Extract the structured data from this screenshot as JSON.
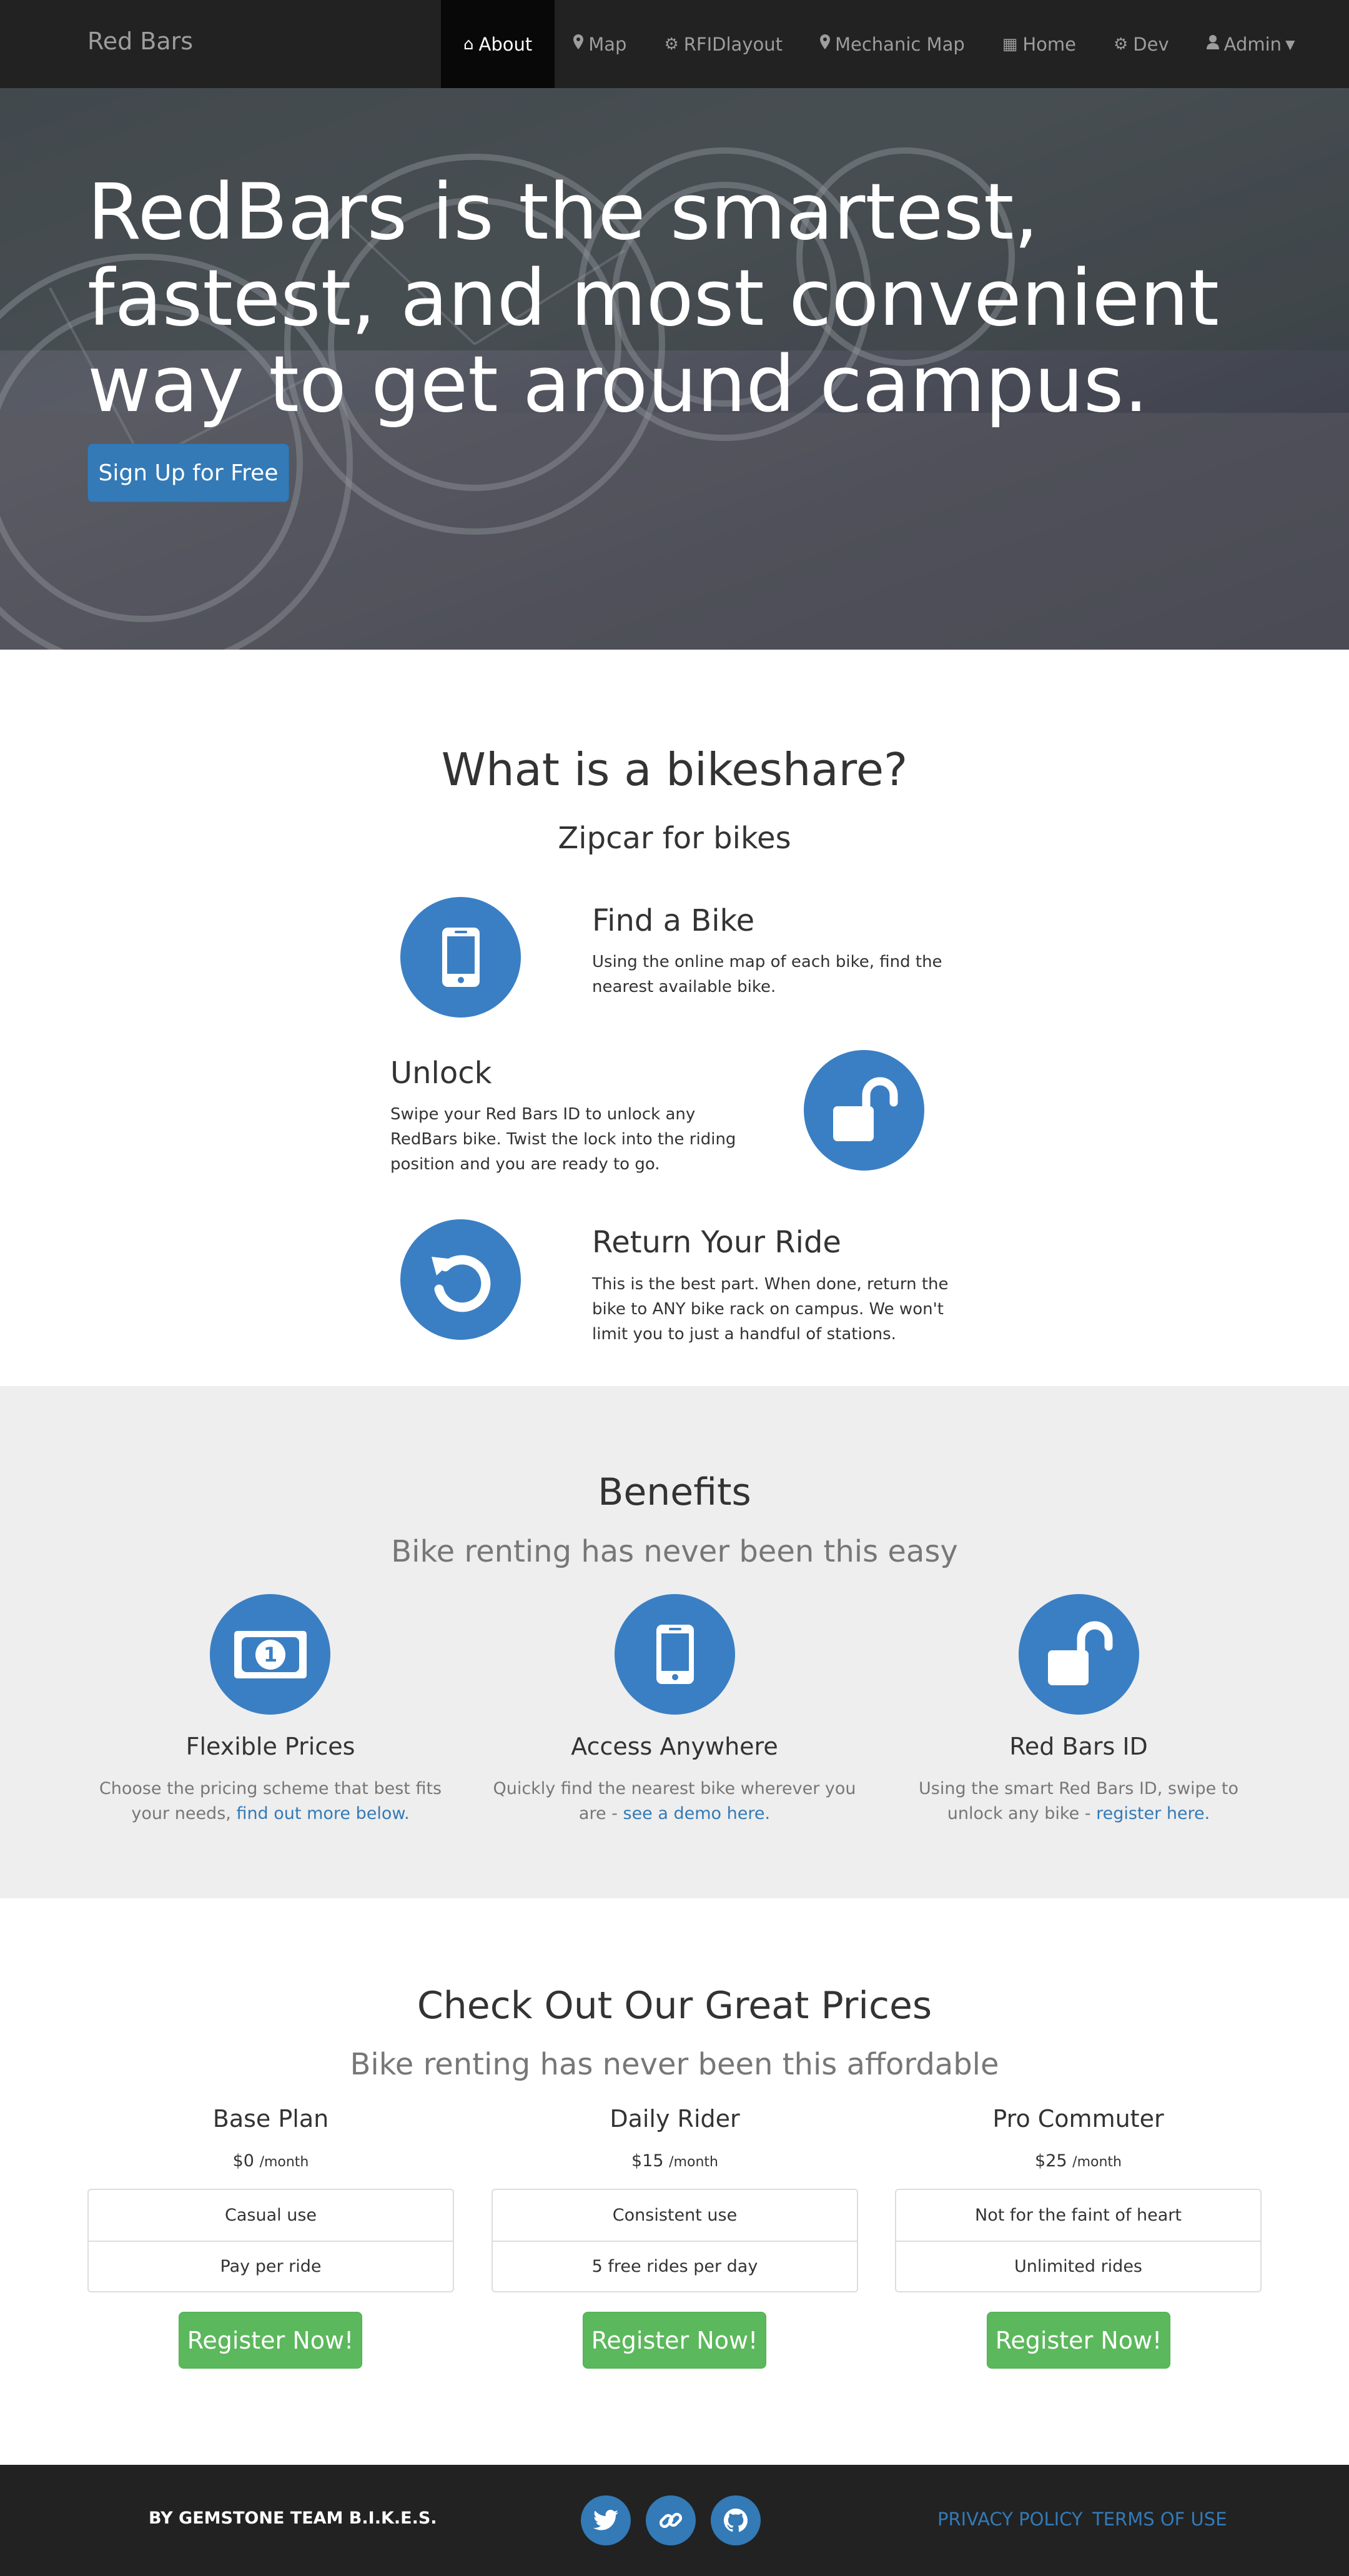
{
  "navbar": {
    "brand": "Red Bars",
    "items": [
      {
        "label": "About",
        "icon": "home-icon"
      },
      {
        "label": "Map",
        "icon": "map-marker-icon"
      },
      {
        "label": "RFIDlayout",
        "icon": "gear-icon"
      },
      {
        "label": "Mechanic Map",
        "icon": "map-marker-icon"
      },
      {
        "label": "Home",
        "icon": "table-icon"
      },
      {
        "label": "Dev",
        "icon": "gear-icon"
      },
      {
        "label": "Admin",
        "icon": "user-icon"
      }
    ]
  },
  "hero": {
    "headline": "RedBars is the smartest, fastest, and most convenient way to get around campus.",
    "cta": "Sign Up for Free"
  },
  "bikeshare": {
    "title": "What is a bikeshare?",
    "subtitle": "Zipcar for bikes",
    "steps": [
      {
        "title": "Find a Bike",
        "text": "Using the online map of each bike, find the nearest available bike.",
        "icon": "mobile-phone-icon"
      },
      {
        "title": "Unlock",
        "text": "Swipe your Red Bars ID to unlock any RedBars bike. Twist the lock into the riding position and you are ready to go.",
        "icon": "unlock-icon"
      },
      {
        "title": "Return Your Ride",
        "text": "This is the best part. When done, return the bike to ANY bike rack on campus. We won't limit you to just a handful of stations.",
        "icon": "undo-icon"
      }
    ]
  },
  "benefits": {
    "title": "Benefits",
    "subtitle": "Bike renting has never been this easy",
    "items": [
      {
        "title": "Flexible Prices",
        "text": "Choose the pricing scheme that best fits your needs,",
        "link": "find out more below.",
        "icon": "money-icon"
      },
      {
        "title": "Access Anywhere",
        "text": "Quickly find the nearest bike wherever you are -",
        "link": "see a demo here.",
        "icon": "mobile-phone-icon"
      },
      {
        "title": "Red Bars ID",
        "text": "Using the smart Red Bars ID, swipe to unlock any bike -",
        "link": "register here.",
        "icon": "unlock-icon"
      }
    ]
  },
  "pricing": {
    "title": "Check Out Our Great Prices",
    "subtitle": "Bike renting has never been this affordable",
    "plans": [
      {
        "name": "Base Plan",
        "price": "$0",
        "period": "/month",
        "features": [
          "Casual use",
          "Pay per ride"
        ],
        "button": "Register Now!"
      },
      {
        "name": "Daily Rider",
        "price": "$15",
        "period": "/month",
        "features": [
          "Consistent use",
          "5 free rides per day"
        ],
        "button": "Register Now!"
      },
      {
        "name": "Pro Commuter",
        "price": "$25",
        "period": "/month",
        "features": [
          "Not for the faint of heart",
          "Unlimited rides"
        ],
        "button": "Register Now!"
      }
    ]
  },
  "footer": {
    "credit": "BY GEMSTONE TEAM B.I.K.E.S.",
    "social": [
      "twitter-icon",
      "link-icon",
      "github-icon"
    ],
    "links": [
      "PRIVACY POLICY",
      "TERMS OF USE"
    ]
  },
  "colors": {
    "primary": "#337ab7",
    "success": "#5cb85c",
    "navbar": "#222222",
    "icon_circle": "#3a7fc4",
    "benefits_bg": "#eeeeee"
  }
}
